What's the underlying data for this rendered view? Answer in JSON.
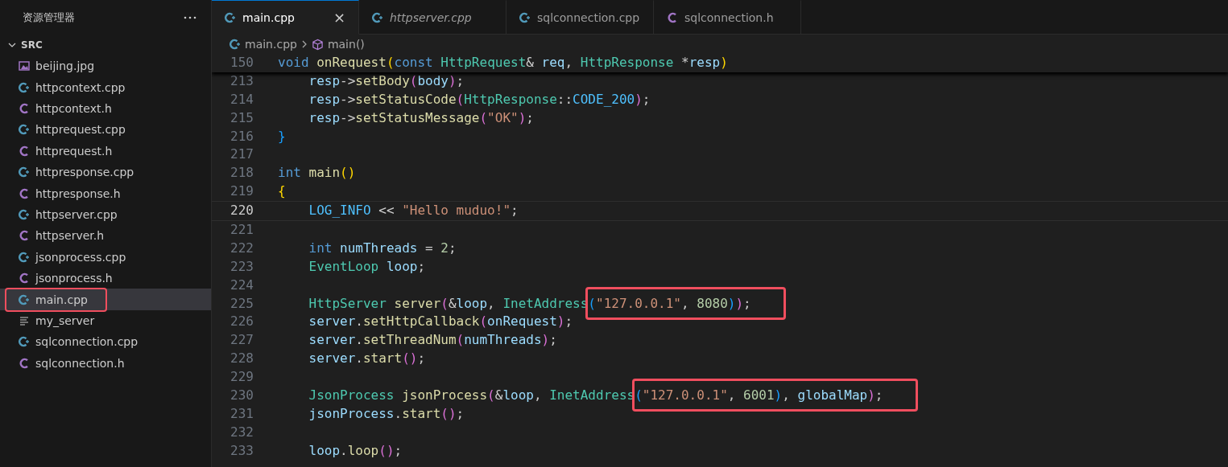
{
  "sidebar": {
    "title": "资源管理器",
    "folder": {
      "name": "SRC",
      "expanded": true
    },
    "items": [
      {
        "name": "beijing.jpg",
        "kind": "image",
        "selected": false,
        "highlighted": false
      },
      {
        "name": "httpcontext.cpp",
        "kind": "cpp",
        "selected": false,
        "highlighted": false
      },
      {
        "name": "httpcontext.h",
        "kind": "h",
        "selected": false,
        "highlighted": false
      },
      {
        "name": "httprequest.cpp",
        "kind": "cpp",
        "selected": false,
        "highlighted": false
      },
      {
        "name": "httprequest.h",
        "kind": "h",
        "selected": false,
        "highlighted": false
      },
      {
        "name": "httpresponse.cpp",
        "kind": "cpp",
        "selected": false,
        "highlighted": false
      },
      {
        "name": "httpresponse.h",
        "kind": "h",
        "selected": false,
        "highlighted": false
      },
      {
        "name": "httpserver.cpp",
        "kind": "cpp",
        "selected": false,
        "highlighted": false
      },
      {
        "name": "httpserver.h",
        "kind": "h",
        "selected": false,
        "highlighted": false
      },
      {
        "name": "jsonprocess.cpp",
        "kind": "cpp",
        "selected": false,
        "highlighted": false
      },
      {
        "name": "jsonprocess.h",
        "kind": "h",
        "selected": false,
        "highlighted": false
      },
      {
        "name": "main.cpp",
        "kind": "cpp",
        "selected": true,
        "highlighted": true
      },
      {
        "name": "my_server",
        "kind": "text",
        "selected": false,
        "highlighted": false
      },
      {
        "name": "sqlconnection.cpp",
        "kind": "cpp",
        "selected": false,
        "highlighted": false
      },
      {
        "name": "sqlconnection.h",
        "kind": "h",
        "selected": false,
        "highlighted": false
      }
    ]
  },
  "tabs": [
    {
      "label": "main.cpp",
      "kind": "cpp",
      "selected": true,
      "preview": false,
      "close": "×"
    },
    {
      "label": "httpserver.cpp",
      "kind": "cpp",
      "selected": false,
      "preview": true
    },
    {
      "label": "sqlconnection.cpp",
      "kind": "cpp",
      "selected": false,
      "preview": false
    },
    {
      "label": "sqlconnection.h",
      "kind": "h",
      "selected": false,
      "preview": false
    }
  ],
  "breadcrumb": [
    {
      "label": "main.cpp",
      "kind": "cpp"
    },
    {
      "label": "main()",
      "kind": "function"
    }
  ],
  "sticky_line": {
    "n": "150",
    "segments": [
      {
        "text": "void onRequest(const HttpRequest& req, HttpResponse *resp)",
        "marked": false
      }
    ]
  },
  "lines": [
    {
      "n": "213",
      "current": false,
      "segments": [
        {
          "text": "    resp->setBody(body);",
          "marked": false
        }
      ]
    },
    {
      "n": "214",
      "current": false,
      "segments": [
        {
          "text": "    resp->setStatusCode(HttpResponse::CODE_200);",
          "marked": false
        }
      ]
    },
    {
      "n": "215",
      "current": false,
      "segments": [
        {
          "text": "    resp->setStatusMessage(\"OK\");",
          "marked": false
        }
      ]
    },
    {
      "n": "216",
      "current": false,
      "segments": [
        {
          "text": "}",
          "marked": false
        }
      ]
    },
    {
      "n": "217",
      "current": false
    },
    {
      "n": "218",
      "current": false,
      "segments": [
        {
          "text": "int main()",
          "marked": false
        }
      ]
    },
    {
      "n": "219",
      "current": false,
      "segments": [
        {
          "text": "{",
          "marked": false
        }
      ]
    },
    {
      "n": "220",
      "current": true,
      "segments": [
        {
          "text": "    LOG_INFO << \"Hello muduo!\";",
          "marked": false
        }
      ]
    },
    {
      "n": "221",
      "current": false
    },
    {
      "n": "222",
      "current": false,
      "segments": [
        {
          "text": "    int numThreads = 2;",
          "marked": false
        }
      ]
    },
    {
      "n": "223",
      "current": false,
      "segments": [
        {
          "text": "    EventLoop loop;",
          "marked": false
        }
      ]
    },
    {
      "n": "224",
      "current": false
    },
    {
      "n": "225",
      "current": false,
      "segments": [
        {
          "text": "    HttpServer server(&loop, InetAddress",
          "marked": false
        },
        {
          "text": "(\"127.0.0.1\", 8080));",
          "marked": true
        }
      ]
    },
    {
      "n": "226",
      "current": false,
      "segments": [
        {
          "text": "    server.setHttpCallback(onRequest);",
          "marked": false
        }
      ]
    },
    {
      "n": "227",
      "current": false,
      "segments": [
        {
          "text": "    server.setThreadNum(numThreads);",
          "marked": false
        }
      ]
    },
    {
      "n": "228",
      "current": false,
      "segments": [
        {
          "text": "    server.start();",
          "marked": false
        }
      ]
    },
    {
      "n": "229",
      "current": false
    },
    {
      "n": "230",
      "current": false,
      "segments": [
        {
          "text": "    JsonProcess jsonProcess(&loop, InetAddress",
          "marked": false
        },
        {
          "text": "(\"127.0.0.1\", 6001), globalMap);",
          "marked": true
        }
      ]
    },
    {
      "n": "231",
      "current": false,
      "segments": [
        {
          "text": "    jsonProcess.start();",
          "marked": false
        }
      ]
    },
    {
      "n": "232",
      "current": false
    },
    {
      "n": "233",
      "current": false,
      "segments": [
        {
          "text": "    loop.loop();",
          "marked": false
        }
      ]
    }
  ]
}
